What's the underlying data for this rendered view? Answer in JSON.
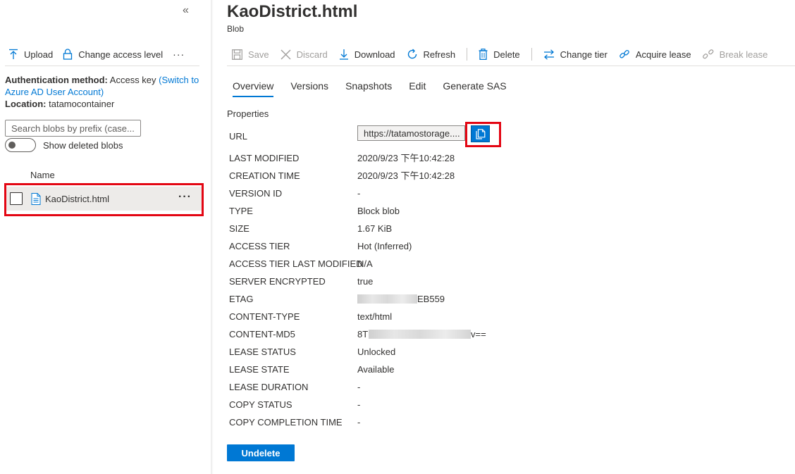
{
  "left_pane": {
    "collapse_glyph": "«",
    "toolbar": {
      "upload_label": "Upload",
      "change_access_label": "Change access level",
      "more_label": "···"
    },
    "auth": {
      "method_label": "Authentication method:",
      "method_value": "Access key",
      "switch_link": "(Switch to Azure AD User Account)",
      "location_label": "Location:",
      "location_value": "tatamocontainer"
    },
    "search": {
      "placeholder": "Search blobs by prefix (case..."
    },
    "toggle": {
      "label": "Show deleted blobs",
      "on": false
    },
    "list": {
      "column_name": "Name",
      "items": [
        {
          "name": "KaoDistrict.html",
          "more": "···"
        }
      ]
    }
  },
  "header": {
    "title": "KaoDistrict.html",
    "subtitle": "Blob"
  },
  "toolbar": {
    "save": "Save",
    "discard": "Discard",
    "download": "Download",
    "refresh": "Refresh",
    "delete": "Delete",
    "change_tier": "Change tier",
    "acquire_lease": "Acquire lease",
    "break_lease": "Break lease"
  },
  "tabs": [
    "Overview",
    "Versions",
    "Snapshots",
    "Edit",
    "Generate SAS"
  ],
  "active_tab": "Overview",
  "properties": {
    "heading": "Properties",
    "url_label": "URL",
    "url_value": "https://tatamostorage....",
    "rows": [
      {
        "key": "LAST MODIFIED",
        "value": "2020/9/23 下午10:42:28"
      },
      {
        "key": "CREATION TIME",
        "value": "2020/9/23 下午10:42:28"
      },
      {
        "key": "VERSION ID",
        "value": "-"
      },
      {
        "key": "TYPE",
        "value": "Block blob"
      },
      {
        "key": "SIZE",
        "value": "1.67 KiB"
      },
      {
        "key": "ACCESS TIER",
        "value": "Hot (Inferred)"
      },
      {
        "key": "ACCESS TIER LAST MODIFIED",
        "value": "N/A"
      },
      {
        "key": "SERVER ENCRYPTED",
        "value": "true"
      },
      {
        "key": "ETAG",
        "value": "EB559"
      },
      {
        "key": "CONTENT-TYPE",
        "value": "text/html"
      },
      {
        "key": "CONTENT-MD5",
        "value": "8T"
      },
      {
        "key": "LEASE STATUS",
        "value": "Unlocked"
      },
      {
        "key": "LEASE STATE",
        "value": "Available"
      },
      {
        "key": "LEASE DURATION",
        "value": "-"
      },
      {
        "key": "COPY STATUS",
        "value": "-"
      },
      {
        "key": "COPY COMPLETION TIME",
        "value": "-"
      }
    ],
    "content_md5_tail": "v=="
  },
  "undelete_label": "Undelete",
  "colors": {
    "accent": "#0078d4",
    "highlight": "#e30613",
    "disabled": "#a19f9d"
  }
}
